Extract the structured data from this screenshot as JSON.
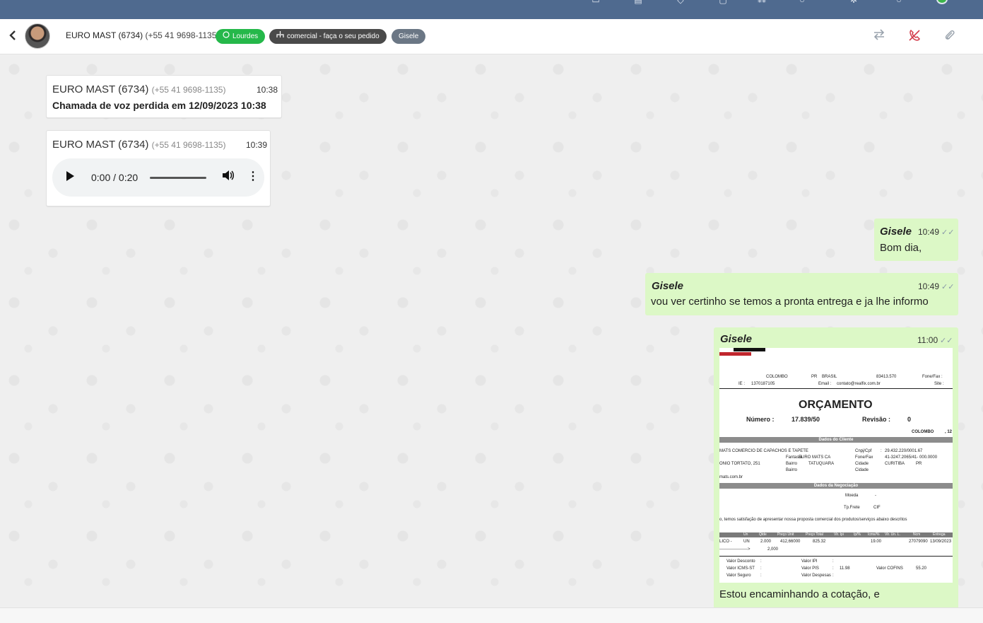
{
  "topbar": {
    "icons": [
      "chat-icon",
      "document-icon",
      "pin-icon",
      "lock-icon",
      "users-icon",
      "clock-icon",
      "settings-icon",
      "help-icon"
    ]
  },
  "header": {
    "back_glyph": "‹",
    "contact_name": "EURO MAST (6734)",
    "contact_phone": "(+55 41 9698-1135)",
    "tags": {
      "attendant": "Lourdes",
      "queue": "comercial - faça o seu pedido",
      "user": "Gisele"
    },
    "colors": {
      "attendant": "#25b84a",
      "queue": "#4a4a4a",
      "user": "#6b7785"
    }
  },
  "messages": {
    "m1": {
      "sender": "EURO MAST (6734)",
      "phone": "(+55 41 9698-1135)",
      "time": "10:38",
      "text": "Chamada de voz perdida em 12/09/2023 10:38"
    },
    "m2": {
      "sender": "EURO MAST (6734)",
      "phone": "(+55 41 9698-1135)",
      "time": "10:39",
      "audio_time": "0:00 / 0:20"
    },
    "m3": {
      "sender": "Gisele",
      "time": "10:49",
      "text": "Bom dia,"
    },
    "m4": {
      "sender": "Gisele",
      "time": "10:49",
      "text": "vou ver certinho se temos a pronta entrega e ja lhe informo"
    },
    "m5": {
      "sender": "Gisele",
      "time": "11:00",
      "caption": "Estou encaminhando a cotação, e",
      "doc": {
        "city": "COLOMBO",
        "state": "PR",
        "country": "BRASIL",
        "zip": "83413.570",
        "fax_label": "Fone/Fax :",
        "ie_label": "IE :",
        "ie": "1370187105",
        "email_label": "Email :",
        "email": "contato@realfix.com.br",
        "site_label": "Site :",
        "title": "ORÇAMENTO",
        "numero_label": "Número :",
        "numero": "17.839/50",
        "revisao_label": "Revisão :",
        "revisao": "0",
        "place": "COLOMBO",
        "place_suffix": ", 12",
        "section_client": "Dados do Cliente",
        "client_name": "MATS COMERCIO DE CAPACHOS E TAPETE",
        "cnpj_label": "Cnpj/Cpf",
        "cnpj": "29.432.220/0001.67",
        "fantasia_label": "Fantasia",
        "fantasia": "EURO MATS CA",
        "fone_label": "Fone/Fax",
        "fone": "41-3247.2065/41- 000.0000",
        "address": "ONIO TORTATO, 251",
        "bairro_label": "Bairro",
        "bairro": "TATUQUARA",
        "cidade_label": "Cidade",
        "cidade": "CURITIBA",
        "uf": "PR",
        "bairro2_label": "Bairro",
        "cidade2_label": "Cidade",
        "site_client": "mats.com.br",
        "section_negotiation": "Dados da Negociação",
        "moeda_label": "Moeda",
        "moeda": "-",
        "frete_label": "Tp.Frete",
        "frete": "CIF",
        "intro": "o, temos satisfação de apresentar nossa proposta comercial dos produtos/serviços abaixo descritos",
        "table_headers": [
          "Un",
          "Qtde",
          "Preço Unit",
          "Preço Total",
          "Vlr. Ipi",
          "Ip/%",
          "Icms/%",
          "Vlr. Un. L.",
          "Ncm",
          "Entrega"
        ],
        "row_item": "LICO -",
        "row_un": "UN",
        "row_qtde": "2.000",
        "row_unit": "412,66000",
        "row_total": "825.32",
        "row_icms": "19.00",
        "row_ncm": "27079090",
        "row_entrega": "13/09/2023",
        "subtotal_arrow": "-------------------->",
        "subtotal_qty": "2,000",
        "desconto_label": "Valor Desconto",
        "ipi_label": "Valor IPI",
        "icmsst_label": "Valor ICMS-ST",
        "pis_label": "Valor PIS",
        "pis": "11.98",
        "cofins_label": "Valor COFINS",
        "cofins": "55.20",
        "seguro_label": "Valor Seguro",
        "despesas_label": "Valor Despesas",
        "colon": ":"
      }
    }
  },
  "misc": {
    "ticks": "✓✓",
    "scroll_glyph": "⌄",
    "more_glyph": "⋮",
    "transfer_glyph": "⇆",
    "phone_glyph": "✆",
    "clip_glyph": "⚲",
    "play_glyph": "",
    "volume_glyph": "🔊"
  }
}
